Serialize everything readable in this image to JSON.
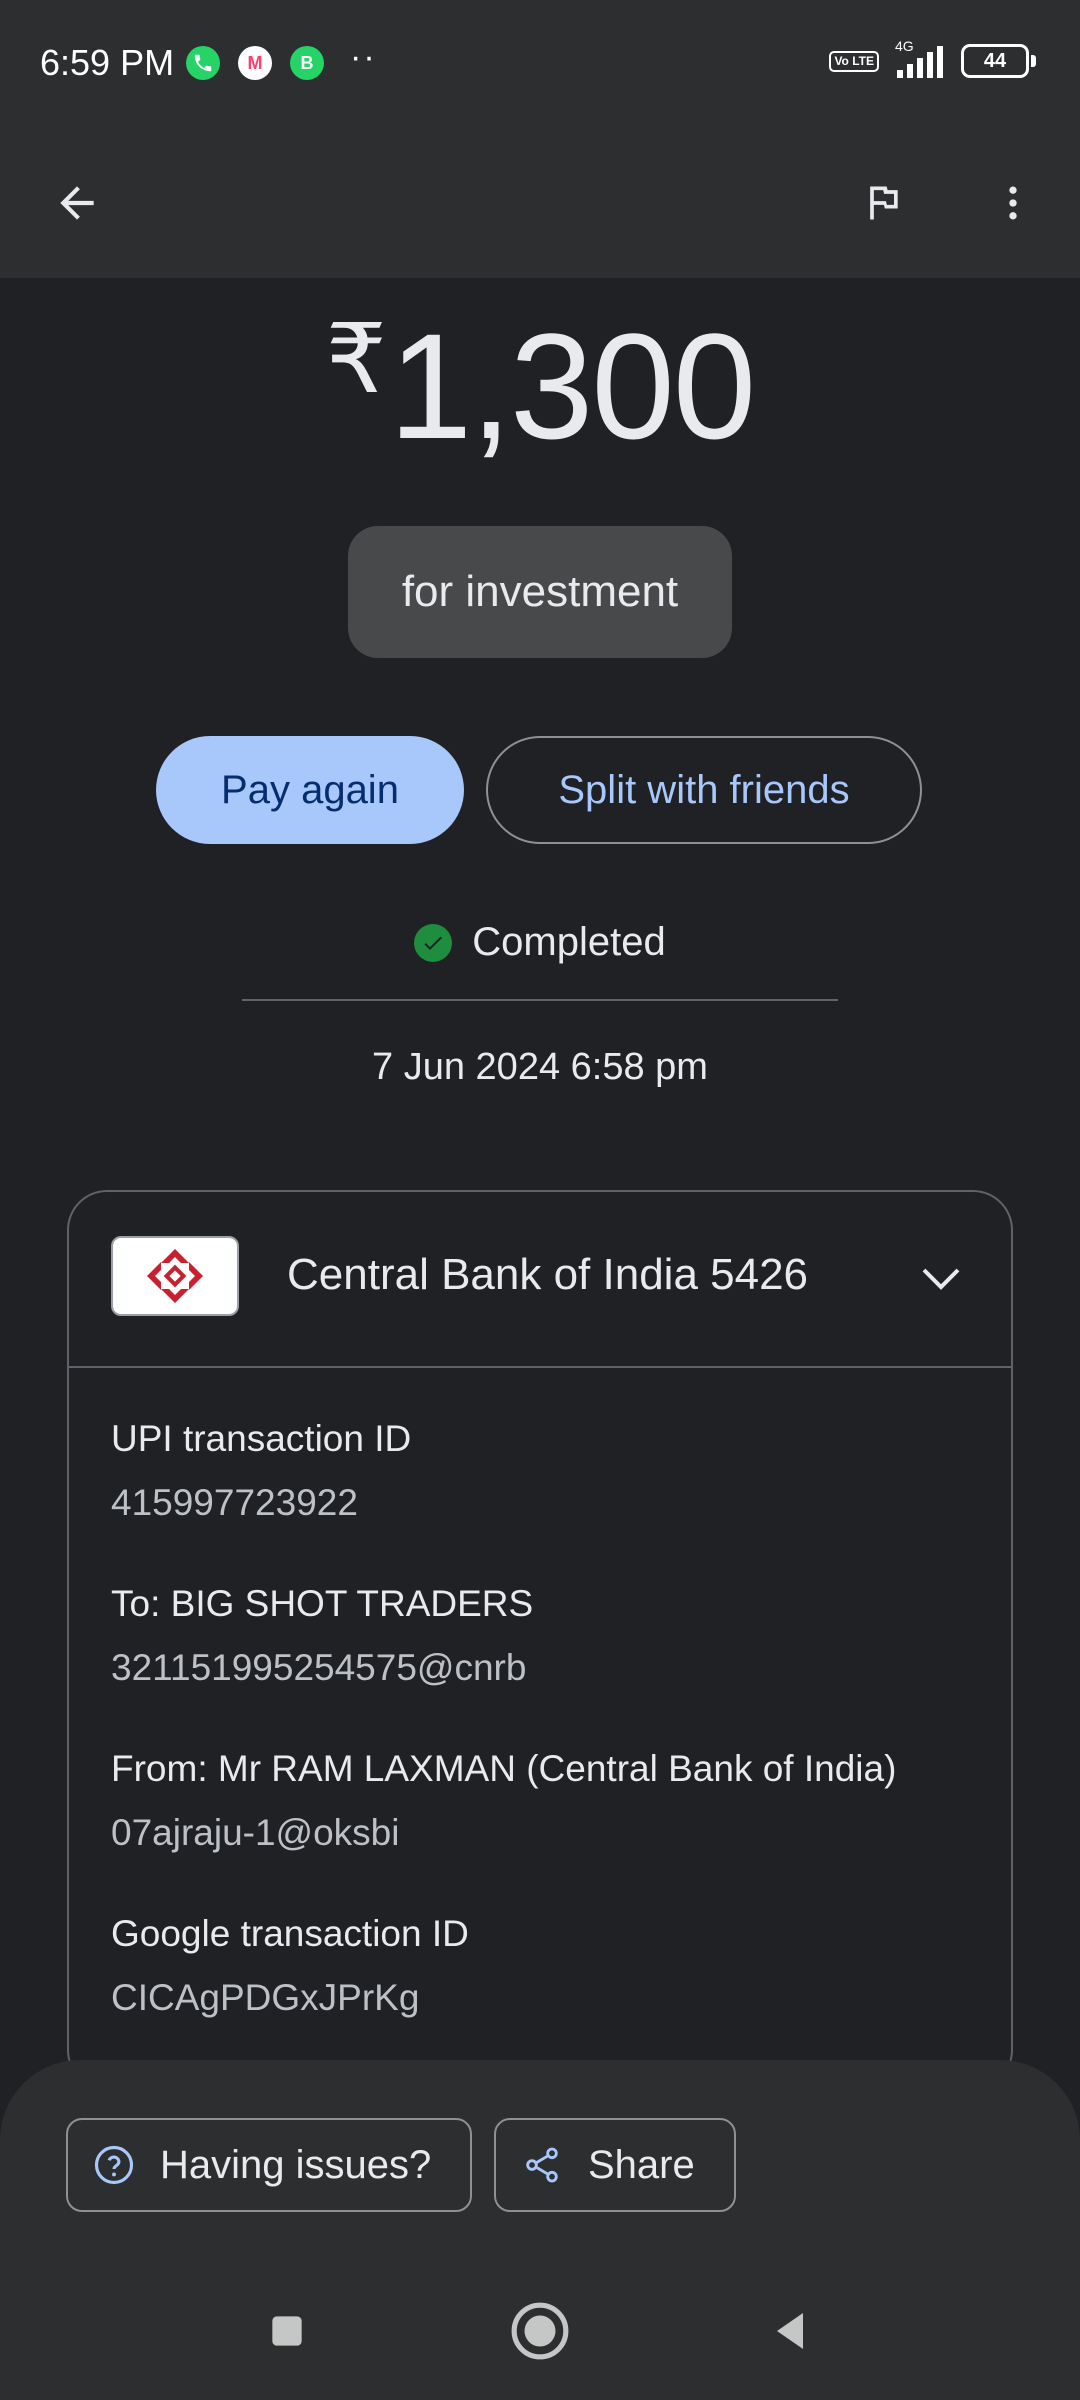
{
  "status_bar": {
    "time": "6:59 PM",
    "more": "··",
    "volte": "Vo LTE",
    "network": "4G",
    "battery": "44",
    "battery_level": 0.44,
    "apps": [
      {
        "icon": "whatsapp-icon",
        "glyph": "✆",
        "color": "#25d366"
      },
      {
        "icon": "myntra-icon",
        "glyph": "M",
        "color": "#ff3f6c"
      },
      {
        "icon": "whatsapp-business-icon",
        "glyph": "B",
        "color": "#25d366"
      }
    ]
  },
  "toolbar": {
    "back_icon": "arrow-left-icon",
    "flag_icon": "flag-icon",
    "more_icon": "more-vertical-icon"
  },
  "payment": {
    "currency": "₹",
    "amount": "1,300",
    "note": "for investment",
    "pay_again_label": "Pay again",
    "split_label": "Split with friends",
    "status": "Completed",
    "status_color": "#1e8e3e",
    "datetime": "7 Jun 2024 6:58 pm"
  },
  "card": {
    "bank_name": "Central Bank of India 5426",
    "details": [
      {
        "label": "UPI transaction ID",
        "value": "415997723922"
      },
      {
        "label": "To: BIG SHOT TRADERS",
        "value": "321151995254575@cnrb"
      },
      {
        "label": "From: Mr RAM  LAXMAN (Central Bank of India)",
        "value": "07ajraju-1@oksbi"
      },
      {
        "label": "Google transaction ID",
        "value": "CICAgPDGxJPrKg"
      }
    ]
  },
  "actions": {
    "issues_label": "Having issues?",
    "share_label": "Share",
    "accent": "#a8c7fa"
  },
  "colors": {
    "background": "#202124",
    "surface": "#2d2e30",
    "primary_button": "#a8c7fa"
  }
}
